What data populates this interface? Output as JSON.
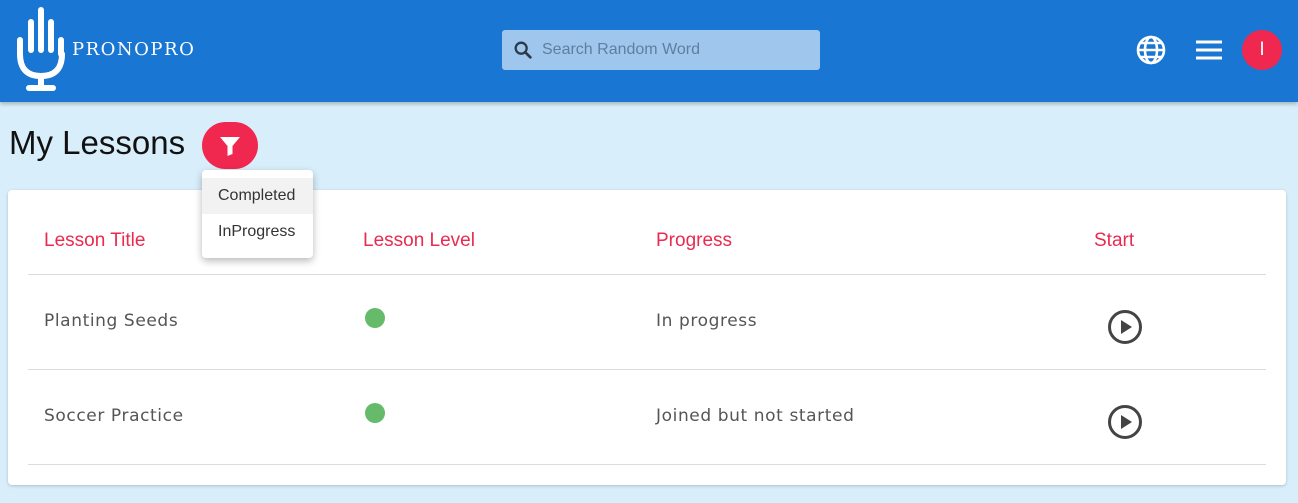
{
  "app": {
    "name": "PRONOPRO",
    "primary_color": "#1976d2",
    "accent_color": "#f0274f"
  },
  "search": {
    "placeholder": "Search Random Word",
    "value": "",
    "icon": "search-icon"
  },
  "header_actions": {
    "language_icon": "globe-icon",
    "menu_icon": "hamburger-menu-icon",
    "avatar_initial": "I"
  },
  "page": {
    "title": "My Lessons",
    "filter_icon": "filter-icon"
  },
  "filter_menu": {
    "items": [
      {
        "label": "Completed",
        "highlighted": true
      },
      {
        "label": "InProgress",
        "highlighted": false
      }
    ]
  },
  "table": {
    "headers": [
      "Lesson Title",
      "Lesson Level",
      "Progress",
      "Start"
    ],
    "rows": [
      {
        "title": "Planting Seeds",
        "level_color": "#66bb6a",
        "progress": "In progress",
        "start_icon": "play-circle-icon"
      },
      {
        "title": "Soccer Practice",
        "level_color": "#66bb6a",
        "progress": "Joined but not started",
        "start_icon": "play-circle-icon"
      }
    ]
  }
}
